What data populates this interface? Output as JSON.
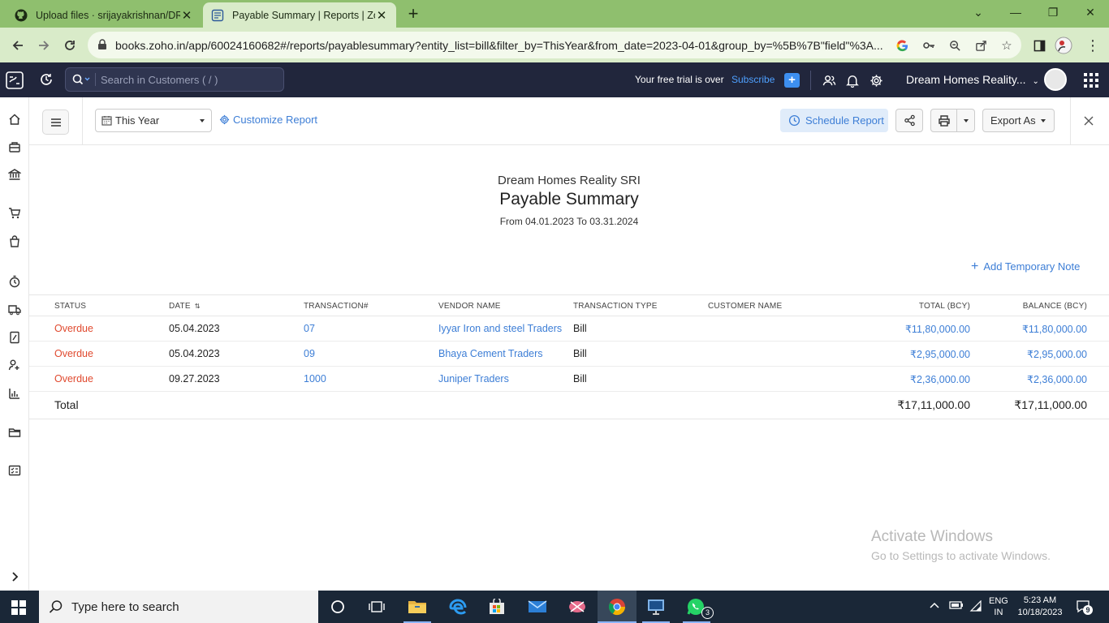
{
  "browser": {
    "tabs": [
      {
        "title": "Upload files · srijayakrishnan/DR",
        "icon": "github-icon"
      },
      {
        "title": "Payable Summary | Reports | Zoho",
        "icon": "zoho-books-icon"
      }
    ],
    "url": "books.zoho.in/app/60024160682#/reports/payablesummary?entity_list=bill&filter_by=ThisYear&from_date=2023-04-01&group_by=%5B%7B\"field\"%3A..."
  },
  "header": {
    "search_placeholder": "Search in Customers ( / )",
    "trial_text": "Your free trial is over",
    "subscribe_label": "Subscribe",
    "org_name": "Dream Homes Reality..."
  },
  "toolbar": {
    "period": "This Year",
    "customize_label": "Customize Report",
    "schedule_label": "Schedule Report",
    "export_label": "Export As"
  },
  "report": {
    "org": "Dream Homes Reality SRI",
    "title": "Payable Summary",
    "range": "From 04.01.2023 To 03.31.2024",
    "temp_note_label": "Add Temporary Note",
    "columns": {
      "status": "STATUS",
      "date": "DATE",
      "transaction": "TRANSACTION#",
      "vendor": "VENDOR NAME",
      "type": "TRANSACTION TYPE",
      "customer": "CUSTOMER NAME",
      "total": "TOTAL (BCY)",
      "balance": "BALANCE (BCY)"
    },
    "rows": [
      {
        "status": "Overdue",
        "date": "05.04.2023",
        "transaction": "07",
        "vendor": "Iyyar Iron and steel Traders",
        "type": "Bill",
        "customer": "",
        "total": "₹11,80,000.00",
        "balance": "₹11,80,000.00"
      },
      {
        "status": "Overdue",
        "date": "05.04.2023",
        "transaction": "09",
        "vendor": "Bhaya Cement Traders",
        "type": "Bill",
        "customer": "",
        "total": "₹2,95,000.00",
        "balance": "₹2,95,000.00"
      },
      {
        "status": "Overdue",
        "date": "09.27.2023",
        "transaction": "1000",
        "vendor": "Juniper Traders",
        "type": "Bill",
        "customer": "",
        "total": "₹2,36,000.00",
        "balance": "₹2,36,000.00"
      }
    ],
    "total_label": "Total",
    "total_amount": "₹17,11,000.00",
    "total_balance": "₹17,11,000.00"
  },
  "watermark": {
    "line1": "Activate Windows",
    "line2": "Go to Settings to activate Windows."
  },
  "taskbar": {
    "search_text": "Type here to search",
    "lang_top": "ENG",
    "lang_bottom": "IN",
    "time": "5:23 AM",
    "date": "10/18/2023",
    "whatsapp_badge": "3",
    "notif_count": "9"
  },
  "colors": {
    "tab_bar": "#8fbf6e",
    "app_header": "#21263c",
    "link": "#3d7ed6",
    "overdue": "#e04a2f",
    "taskbar": "#1a2737"
  }
}
